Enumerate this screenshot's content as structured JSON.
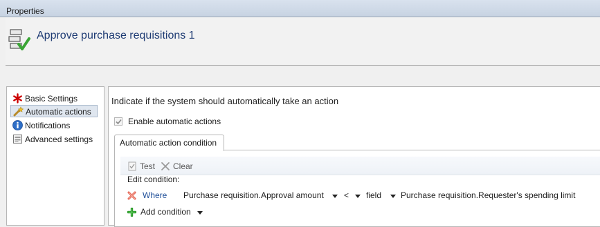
{
  "window": {
    "title": "Properties"
  },
  "header": {
    "title": "Approve purchase requisitions 1"
  },
  "nav": {
    "items": [
      {
        "label": "Basic Settings"
      },
      {
        "label": "Automatic actions"
      },
      {
        "label": "Notifications"
      },
      {
        "label": "Advanced settings"
      }
    ],
    "selected": "Automatic actions"
  },
  "main": {
    "instruction": "Indicate if the system should automatically take an action",
    "enable_checkbox": {
      "label": "Enable automatic actions",
      "checked": true
    },
    "tab": {
      "label": "Automatic action condition"
    },
    "toolbar": {
      "test_label": "Test",
      "clear_label": "Clear"
    },
    "edit_condition_label": "Edit condition:",
    "condition": {
      "where_label": "Where",
      "field": "Purchase requisition.Approval amount",
      "operator": "<",
      "value_type": "field",
      "value": "Purchase requisition.Requester's spending limit"
    },
    "add_condition_label": "Add condition"
  },
  "colors": {
    "title": "#1e3b73",
    "link": "#1f4f99",
    "required": "#cc0000"
  }
}
